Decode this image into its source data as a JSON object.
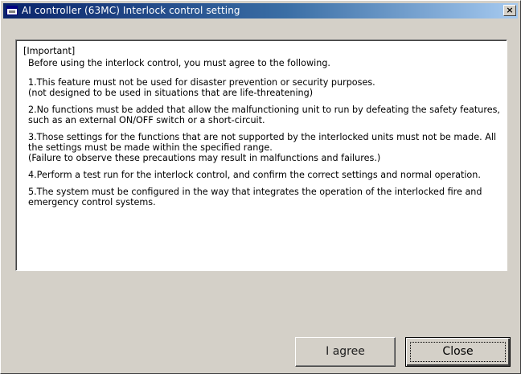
{
  "window": {
    "title": "AI controller (63MC) Interlock control setting",
    "close_glyph": "×"
  },
  "notice": {
    "heading": "[Important]",
    "intro": "Before using the interlock control, you must agree to the following.",
    "items": [
      {
        "lines": [
          "1.This feature must not be used for disaster prevention or security purposes.",
          "(not designed to be used in situations that are life-threatening)"
        ]
      },
      {
        "lines": [
          "2.No functions must be added that allow the malfunctioning unit to run by defeating the safety features, such as an external ON/OFF switch or a short-circuit."
        ]
      },
      {
        "lines": [
          "3.Those settings for the functions that are not supported by the interlocked units must not be made. All the settings must be made within the specified range.",
          "(Failure to observe these precautions may result in malfunctions and failures.)"
        ]
      },
      {
        "lines": [
          "4.Perform a test run for the interlock control, and confirm the correct settings and normal operation."
        ]
      },
      {
        "lines": [
          "5.The system must be configured in the way that integrates the operation of the interlocked fire and emergency control systems."
        ]
      }
    ]
  },
  "buttons": {
    "agree_label": "I agree",
    "close_label": "Close"
  }
}
